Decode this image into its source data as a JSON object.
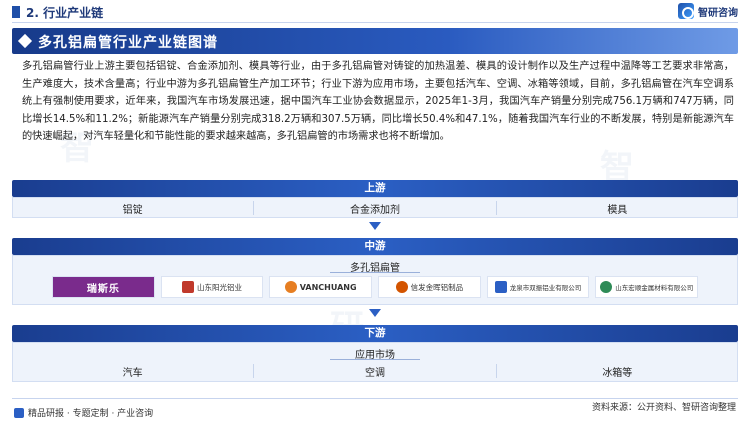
{
  "header": {
    "section_title": "2. 行业产业链",
    "brand": "智研咨询"
  },
  "banner": {
    "title": "多孔铝扁管行业产业链图谱"
  },
  "intro": "多孔铝扁管行业上游主要包括铝锭、合金添加剂、模具等行业，由于多孔铝扁管对铸锭的加热温差、模具的设计制作以及生产过程中温降等工艺要求非常高，生产难度大，技术含量高；行业中游为多孔铝扁管生产加工环节；行业下游为应用市场，主要包括汽车、空调、冰箱等领域，目前，多孔铝扁管在汽车空调系统上有强制使用要求，近年来，我国汽车市场发展迅速，据中国汽车工业协会数据显示，2025年1-3月，我国汽车产销量分别完成756.1万辆和747万辆，同比增长14.5%和11.2%；新能源汽车产销量分别完成318.2万辆和307.5万辆，同比增长50.4%和47.1%，随着我国汽车行业的不断发展，特别是新能源汽车的快速崛起，对汽车轻量化和节能性能的要求越来越高，多孔铝扁管的市场需求也将不断增加。",
  "upstream": {
    "label": "上游",
    "items": [
      "铝锭",
      "合金添加剂",
      "模具"
    ]
  },
  "midstream": {
    "label": "中游",
    "product": "多孔铝扁管",
    "companies": [
      {
        "name": "瑞斯乐",
        "color": "#7a2b8c"
      },
      {
        "name": "山东阳光铝业",
        "color": "#c0392b"
      },
      {
        "name": "VANCHUANG",
        "color": "#e67e22"
      },
      {
        "name": "信发金晖铝制品",
        "color": "#d35400"
      },
      {
        "name": "龙泉市双振铝业有限公司",
        "color": "#2b5fc4"
      },
      {
        "name": "山东宏顺金属材料有限公司",
        "color": "#2e8b57"
      }
    ]
  },
  "downstream": {
    "label": "下游",
    "market": "应用市场",
    "items": [
      "汽车",
      "空调",
      "冰箱等"
    ]
  },
  "footer": {
    "left": "精品研报 · 专题定制 · 产业咨询",
    "source": "资料来源：公开资料、智研咨询整理"
  },
  "colors": {
    "primary": "#2b5fc4",
    "dark": "#1a3d8f",
    "panel": "#eef3fb"
  }
}
